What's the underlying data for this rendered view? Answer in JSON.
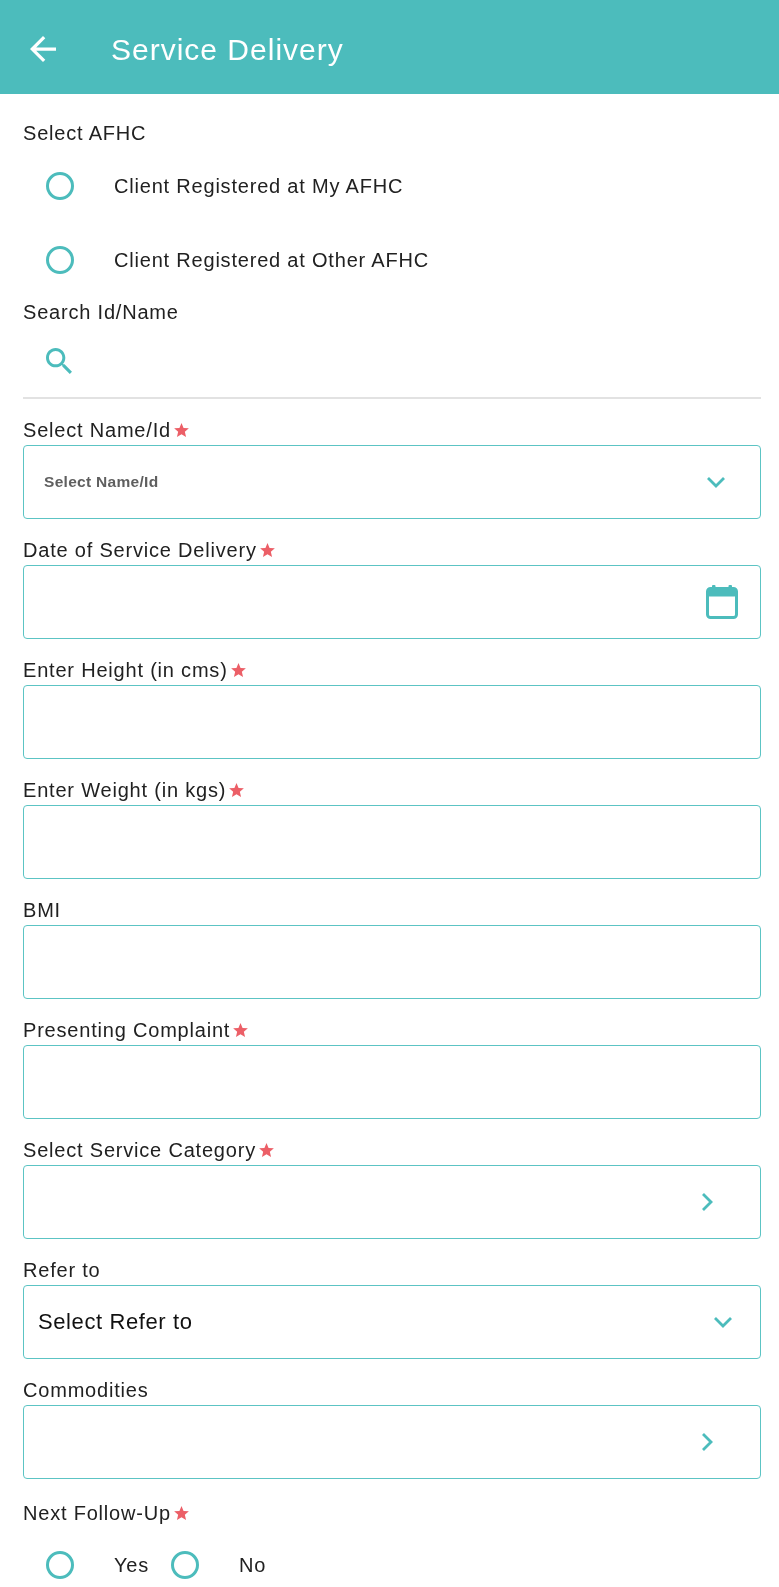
{
  "header": {
    "title": "Service Delivery"
  },
  "afhc": {
    "label": "Select AFHC",
    "options": [
      {
        "label": "Client Registered at My AFHC",
        "selected": false
      },
      {
        "label": "Client Registered at Other AFHC",
        "selected": false
      }
    ]
  },
  "search": {
    "label": "Search Id/Name"
  },
  "fields": [
    {
      "label": "Select Name/Id",
      "required": true,
      "kind": "dropdown",
      "placeholder": "Select Name/Id"
    },
    {
      "label": "Date of Service Delivery",
      "required": true,
      "kind": "date"
    },
    {
      "label": "Enter Height (in cms)",
      "required": true,
      "kind": "text"
    },
    {
      "label": "Enter Weight (in kgs)",
      "required": true,
      "kind": "text"
    },
    {
      "label": "BMI",
      "required": false,
      "kind": "text"
    },
    {
      "label": "Presenting Complaint",
      "required": true,
      "kind": "text"
    },
    {
      "label": "Select Service Category",
      "required": true,
      "kind": "picker"
    },
    {
      "label": "Refer to",
      "required": false,
      "kind": "dropdown",
      "value": "Select Refer to"
    },
    {
      "label": "Commodities",
      "required": false,
      "kind": "picker"
    }
  ],
  "follow_up": {
    "label": "Next Follow-Up",
    "required": true,
    "options": [
      {
        "label": "Yes",
        "selected": false
      },
      {
        "label": "No",
        "selected": false
      }
    ]
  }
}
